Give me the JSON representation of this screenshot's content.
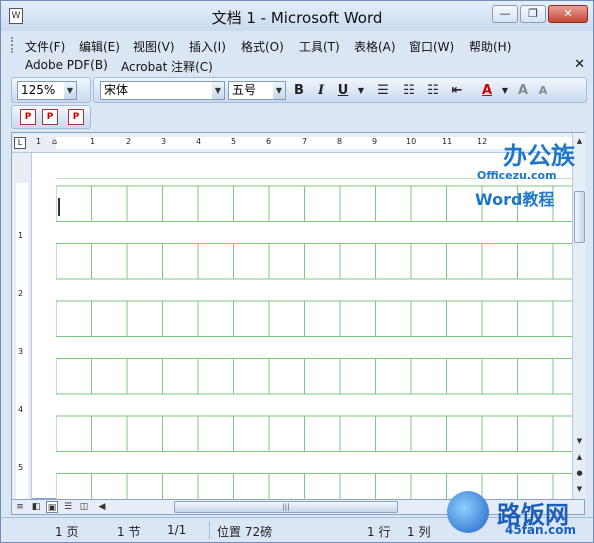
{
  "window": {
    "title": "文档 1 - Microsoft Word",
    "app_icon": "W"
  },
  "menu": {
    "items": [
      "文件(F)",
      "编辑(E)",
      "视图(V)",
      "插入(I)",
      "格式(O)",
      "工具(T)",
      "表格(A)",
      "窗口(W)",
      "帮助(H)"
    ],
    "row2": [
      "Adobe PDF(B)",
      "Acrobat 注释(C)"
    ]
  },
  "toolbar": {
    "zoom": "125%",
    "font": "宋体",
    "size": "五号",
    "bold": "B",
    "italic": "I",
    "underline": "U"
  },
  "status": {
    "page": "1 页",
    "section": "1 节",
    "pages": "1/1",
    "position": "位置 72磅",
    "line": "1 行",
    "column": "1 列"
  },
  "watermark": {
    "zh": "办公族",
    "url": "Officezu.com",
    "tutorial": "Word教程",
    "site_zh": "路饭网",
    "site_url": "45fan.com"
  },
  "colors": {
    "grid": "#7fc67f",
    "font_color": "#cc0000",
    "accent": "#1e77c7"
  },
  "ruler": {
    "h": [
      "1",
      "1",
      "2",
      "3",
      "4",
      "5",
      "6",
      "7",
      "8",
      "9",
      "10",
      "11",
      "12"
    ],
    "v": [
      "1",
      "2",
      "3",
      "4",
      "5"
    ]
  }
}
